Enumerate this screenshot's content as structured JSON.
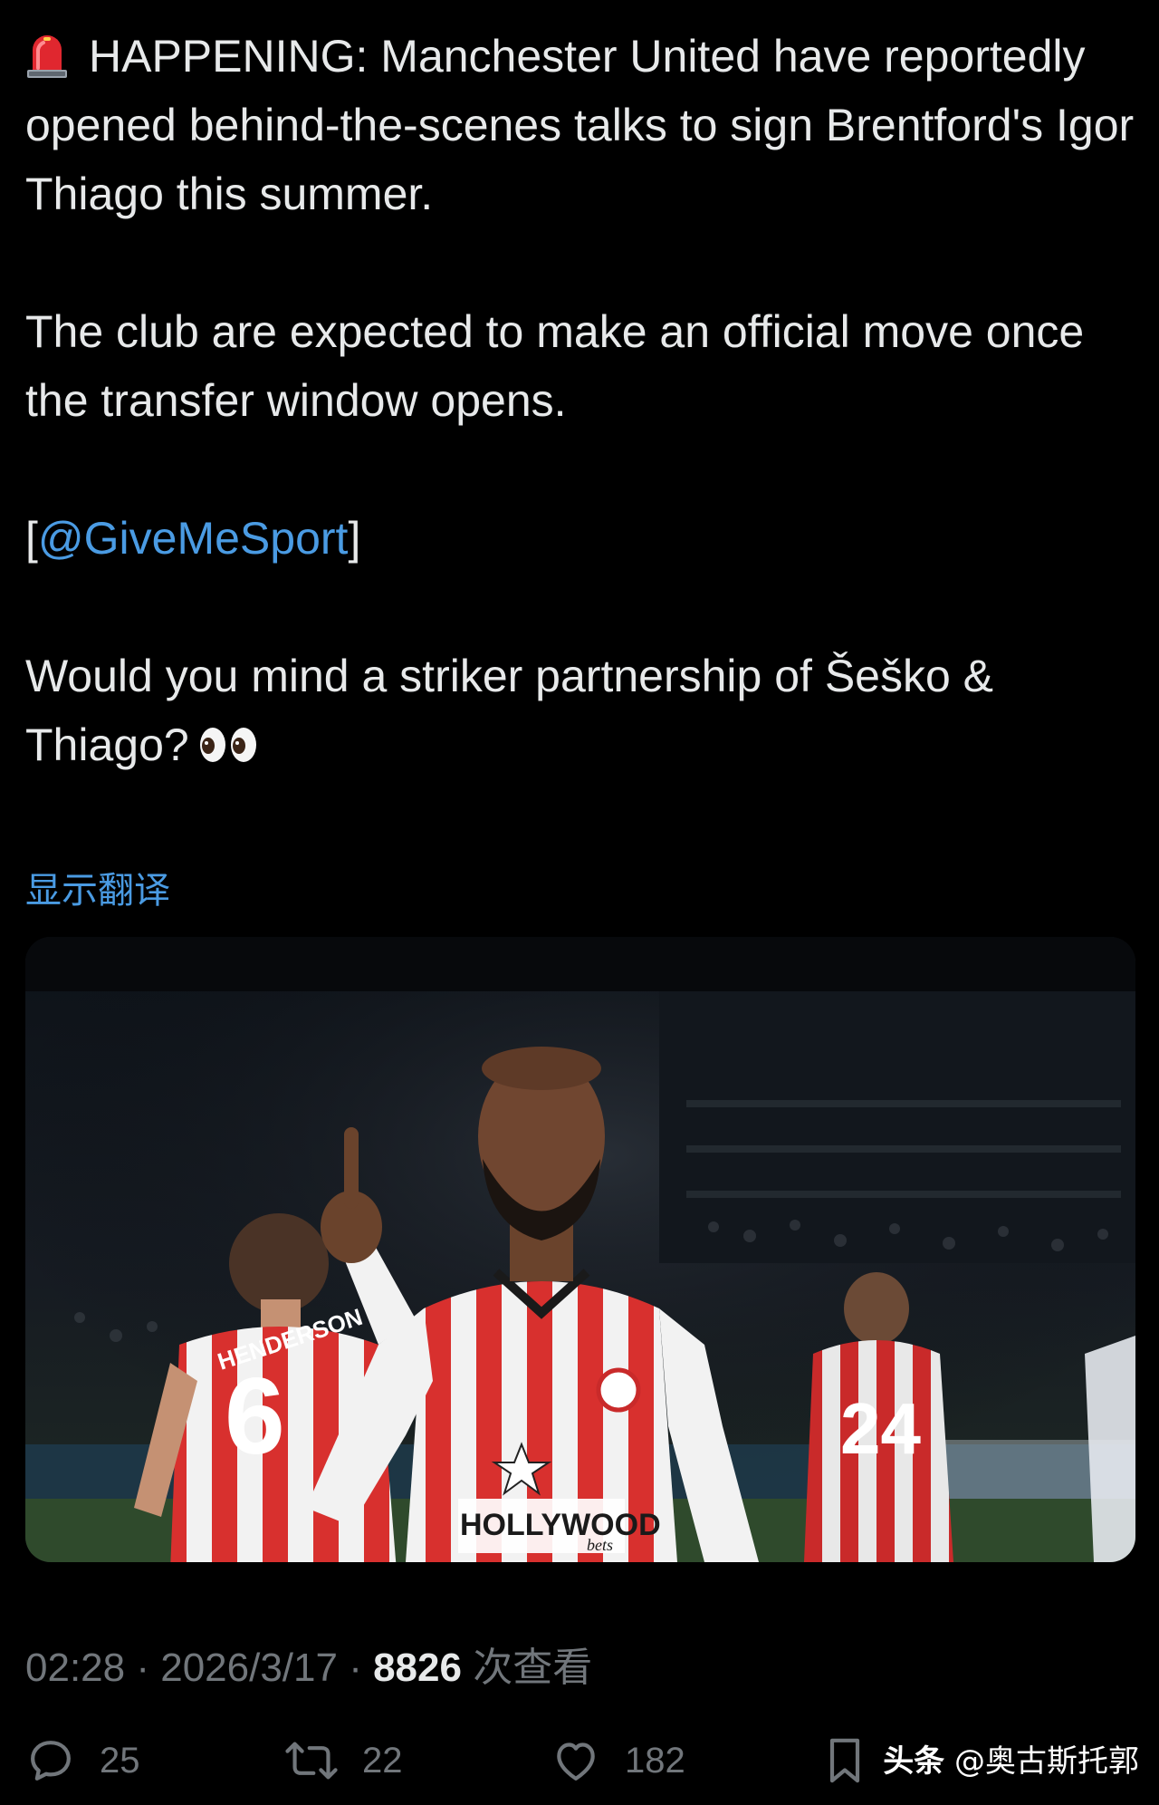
{
  "tweet": {
    "paragraphs": {
      "p1": "HAPPENING: Manchester United have reportedly opened behind-the-scenes talks to sign Brentford's Igor Thiago this summer.",
      "p2": "The club are expected to make an official move once the transfer window opens.",
      "p3_open": "[",
      "p3_mention": "@GiveMeSport",
      "p3_close": "]",
      "p4": "Would you mind a striker partnership of Šeško & Thiago?"
    },
    "icons": {
      "siren": "police-car-light-emoji",
      "eyes": "eyes-emoji"
    },
    "show_translation": "显示翻译",
    "media": {
      "kit_sponsor": "HOLLYWOOD",
      "kit_sponsor_sub": "bets",
      "left_player_number": "6",
      "left_player_name": "HENDERSON",
      "right_player_number": "24"
    },
    "meta": {
      "time": "02:28",
      "sep1": " · ",
      "date": "2026/3/17",
      "sep2": " · ",
      "views_count": "8826",
      "views_label": " 次查看"
    },
    "actions": {
      "replies": "25",
      "reposts": "22",
      "likes": "182"
    },
    "watermark": {
      "brand": "头条",
      "handle": " @奥古斯托郭"
    }
  },
  "colors": {
    "background": "#000000",
    "text": "#e7e9ea",
    "muted": "#71767b",
    "link": "#4a9be3"
  }
}
